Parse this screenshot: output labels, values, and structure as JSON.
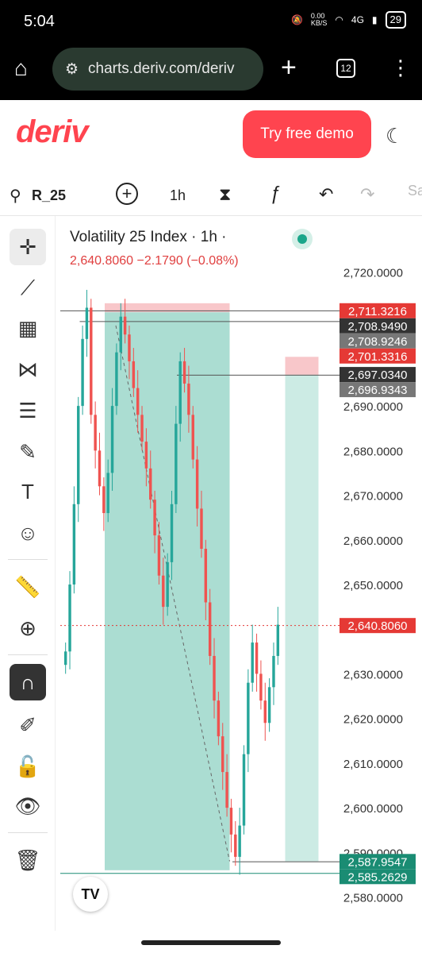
{
  "status": {
    "time": "5:04",
    "net_speed": "0.00\nKB/S",
    "signal": "4G",
    "battery": "29"
  },
  "browser": {
    "url": "charts.deriv.com/deriv",
    "tab_count": "12"
  },
  "header": {
    "logo": "deriv",
    "demo_button": "Try free demo"
  },
  "toolbar": {
    "symbol": "R_25",
    "interval": "1h",
    "partial": "Sa"
  },
  "legend": {
    "title": "Volatility 25 Index · 1h ·",
    "values": "2,640.8060  −2.1790 (−0.08%)"
  },
  "chart_data": {
    "type": "candlestick",
    "ylim": [
      2576,
      2724
    ],
    "y_ticks": [
      "2,720.0000",
      "2,690.0000",
      "2,680.0000",
      "2,670.0000",
      "2,660.0000",
      "2,650.0000",
      "2,620.0000",
      "2,610.0000",
      "2,600.0000",
      "2,590.0000",
      "2,580.0000"
    ],
    "y_tick_values": [
      2720,
      2690,
      2680,
      2670,
      2660,
      2650,
      2620,
      2610,
      2600,
      2590,
      2580
    ],
    "partial_tick": "2,630.0000",
    "partial_tick_value": 2630,
    "price_labels": [
      {
        "text": "2,711.3216",
        "value": 2711.3216,
        "color": "#e53935"
      },
      {
        "text": "2,708.9490",
        "value": 2708.949,
        "color": "#333333"
      },
      {
        "text": "2,708.9246",
        "value": 2708.9246,
        "color": "#777777"
      },
      {
        "text": "2,701.3316",
        "value": 2701.3316,
        "color": "#e53935"
      },
      {
        "text": "2,697.0340",
        "value": 2697.034,
        "color": "#333333"
      },
      {
        "text": "2,696.9343",
        "value": 2696.9343,
        "color": "#777777"
      },
      {
        "text": "2,640.8060",
        "value": 2640.806,
        "color": "#e53935"
      },
      {
        "text": "2,587.9547",
        "value": 2587.9547,
        "color": "#1a8c73"
      },
      {
        "text": "2,585.2629",
        "value": 2585.2629,
        "color": "#1a8c73"
      }
    ],
    "current_price": 2640.806,
    "candles_close": [
      2635,
      2650,
      2668,
      2690,
      2705,
      2712,
      2688,
      2680,
      2672,
      2666,
      2675,
      2690,
      2702,
      2710,
      2706,
      2700,
      2694,
      2688,
      2682,
      2676,
      2669,
      2661,
      2652,
      2645,
      2655,
      2668,
      2686,
      2700,
      2695,
      2688,
      2678,
      2667,
      2658,
      2646,
      2634,
      2624,
      2616,
      2608,
      2600,
      2594,
      2589,
      2596,
      2612,
      2628,
      2637,
      2630,
      2624,
      2619,
      2627,
      2634,
      2641
    ],
    "colors": {
      "up": "#26a69a",
      "down": "#ef5350",
      "zone_green": "#8fd2c3",
      "zone_red": "#f6b9bd"
    }
  }
}
